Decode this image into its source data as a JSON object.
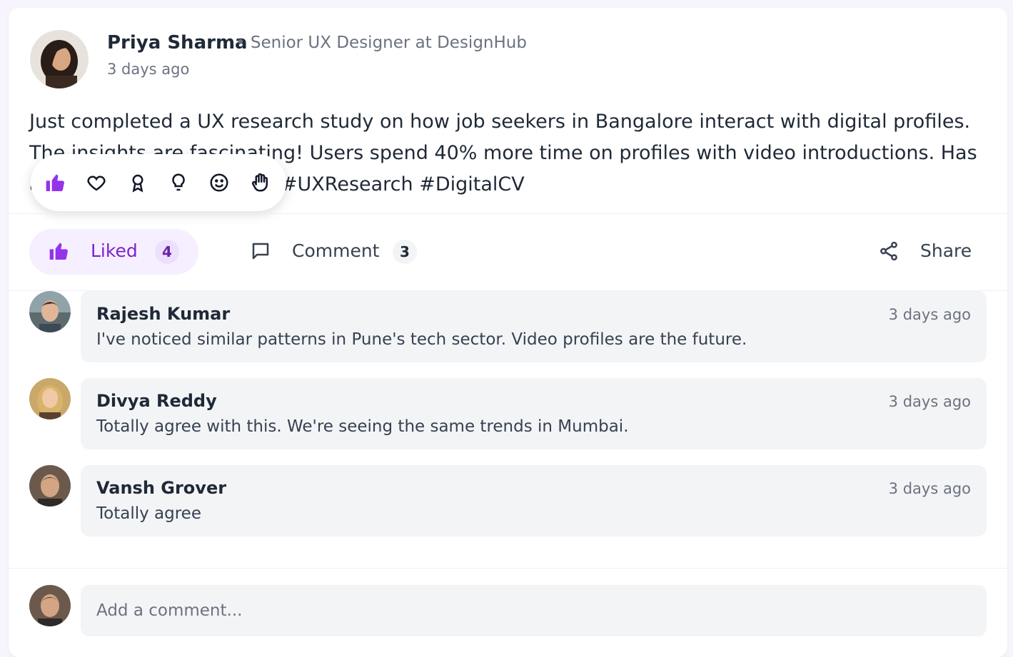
{
  "post": {
    "author_name": "Priya Sharma",
    "author_role": "• Senior UX Designer at DesignHub",
    "time": "3 days ago",
    "body": "Just completed a UX research study on how job seekers in Bangalore interact with digital profiles. The insights are fascinating! Users spend 40% more time on profiles with video introductions. Has anyone else noticed this? #UXResearch #DigitalCV"
  },
  "reactions": [
    "like-icon",
    "heart-icon",
    "award-icon",
    "lightbulb-icon",
    "smile-icon",
    "hand-icon"
  ],
  "actions": {
    "like_label": "Liked",
    "like_count": "4",
    "comment_label": "Comment",
    "comment_count": "3",
    "share_label": "Share"
  },
  "comments": [
    {
      "name": "Rajesh Kumar",
      "time": "3 days ago",
      "text": "I've noticed similar patterns in Pune's tech sector. Video profiles are the future."
    },
    {
      "name": "Divya Reddy",
      "time": "3 days ago",
      "text": "Totally agree with this. We're seeing the same trends in Mumbai."
    },
    {
      "name": "Vansh Grover",
      "time": "3 days ago",
      "text": "Totally agree"
    }
  ],
  "add_comment": {
    "placeholder": "Add a comment..."
  },
  "colors": {
    "accent": "#9333ea",
    "accent_bg": "#f6efff",
    "bubble_bg": "#f3f4f6"
  }
}
